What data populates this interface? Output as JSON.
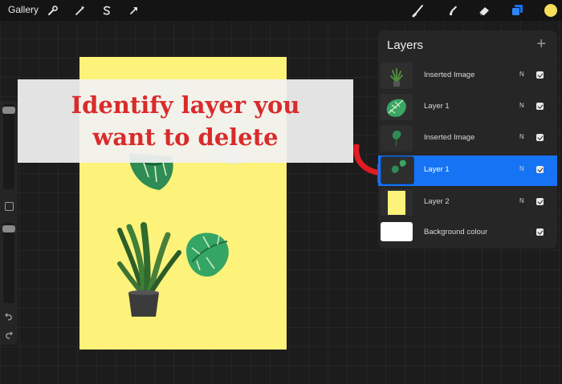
{
  "topbar": {
    "gallery_label": "Gallery",
    "left_tools": [
      "wrench-icon",
      "magic-wand-icon",
      "selection-icon",
      "transform-arrow-icon"
    ],
    "right_tools": [
      "brush-icon",
      "smudge-icon",
      "eraser-icon",
      "layers-icon"
    ],
    "current_color": "#f6dd5a",
    "accent": "#1673f4"
  },
  "canvas": {
    "background_color": "#fdf27a"
  },
  "banner": {
    "line1": "Identify layer you",
    "line2": "want to delete",
    "text_color": "#d92b2b"
  },
  "layers_panel": {
    "title": "Layers",
    "add_label": "+",
    "layers": [
      {
        "name": "Inserted Image",
        "blend": "N",
        "visible": true,
        "selected": false
      },
      {
        "name": "Layer 1",
        "blend": "N",
        "visible": true,
        "selected": false
      },
      {
        "name": "Inserted Image",
        "blend": "N",
        "visible": true,
        "selected": false
      },
      {
        "name": "Layer 1",
        "blend": "N",
        "visible": true,
        "selected": true
      },
      {
        "name": "Layer 2",
        "blend": "N",
        "visible": true,
        "selected": false
      },
      {
        "name": "Background colour",
        "blend": "",
        "visible": true,
        "selected": false
      }
    ]
  }
}
